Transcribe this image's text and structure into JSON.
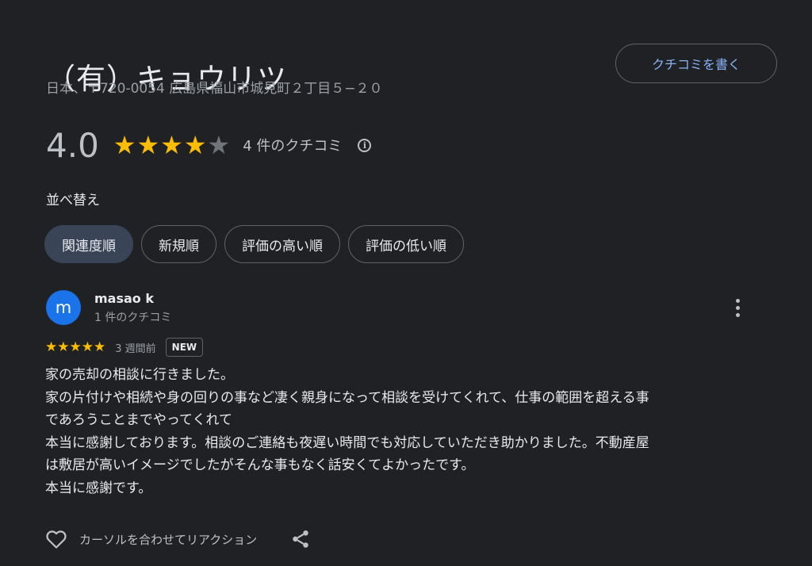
{
  "place": {
    "title": "（有）キョウリツ",
    "address": "日本、〒720-0054 広島県福山市城見町２丁目５−２０"
  },
  "header": {
    "write_review_label": "クチコミを書く"
  },
  "rating": {
    "value": "4.0",
    "stars": 4,
    "max_stars": 5,
    "review_count_label": "4 件のクチコミ"
  },
  "sort": {
    "label": "並べ替え",
    "options": [
      "関連度順",
      "新規順",
      "評価の高い順",
      "評価の低い順"
    ],
    "selected": "関連度順"
  },
  "review": {
    "avatar_letter": "m",
    "author": "masao k",
    "author_meta": "1 件のクチコミ",
    "stars": 5,
    "date": "3 週間前",
    "badge": "NEW",
    "text_lines": [
      "家の売却の相談に行きました。",
      "家の片付けや相続や身の回りの事など凄く親身になって相談を受けてくれて、仕事の範囲を超える事",
      "であろうことまでやってくれて",
      "本当に感謝しております。相談のご連絡も夜遅い時間でも対応していただき助かりました。不動産屋",
      "は敷居が高いイメージでしたがそんな事もなく話安くてよかったです。",
      "本当に感謝です。"
    ],
    "reaction_label": "カーソルを合わせてリアクション"
  },
  "colors": {
    "background": "#202124",
    "star_on": "#fbbc04",
    "star_off": "#70757a",
    "accent": "#8ab4f8",
    "selected_chip": "#394457",
    "avatar": "#1a73e8"
  },
  "icons": [
    "info-icon",
    "more-vert-icon",
    "heart-icon",
    "share-icon",
    "star-icon"
  ]
}
